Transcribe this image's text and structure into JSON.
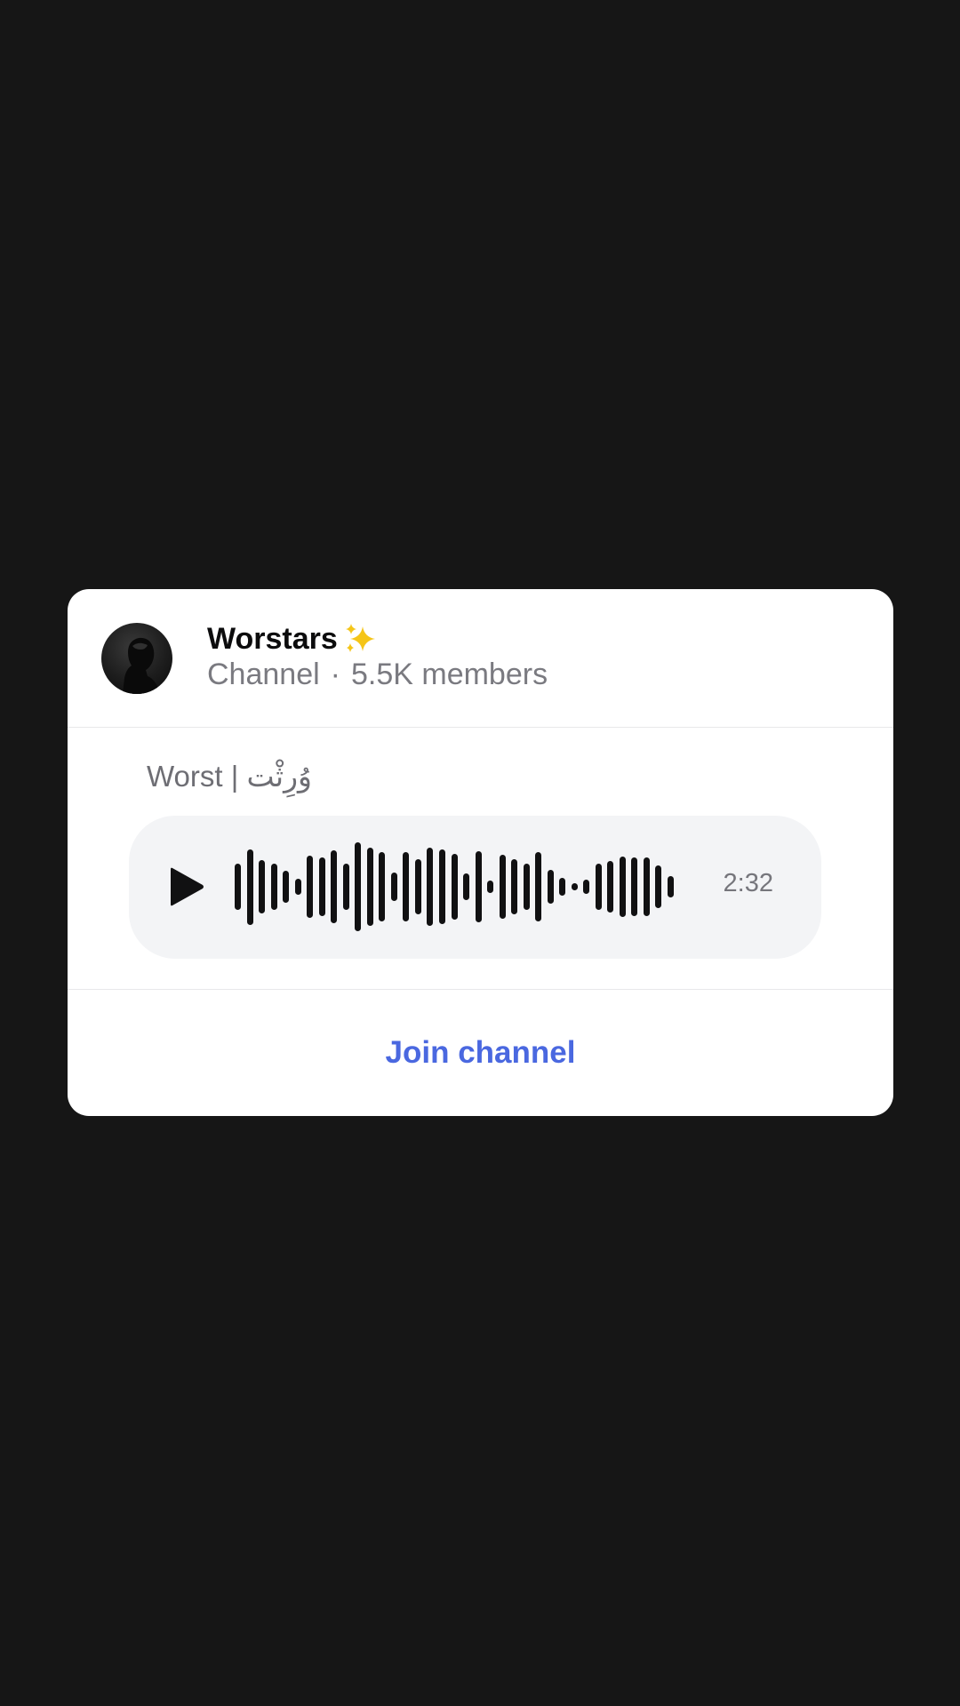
{
  "channel": {
    "name": "Worstars",
    "name_emoji_icon": "sparkles-icon",
    "type_label": "Channel",
    "separator": "·",
    "members": "5.5K members"
  },
  "post": {
    "title": "Worst | وُرِثْت"
  },
  "voice_message": {
    "play_icon": "play-icon",
    "duration": "2:32",
    "waveform_levels": [
      0.52,
      0.85,
      0.6,
      0.52,
      0.36,
      0.18,
      0.7,
      0.66,
      0.82,
      0.52,
      1.0,
      0.88,
      0.78,
      0.32,
      0.78,
      0.62,
      0.88,
      0.84,
      0.74,
      0.3,
      0.8,
      0.14,
      0.72,
      0.62,
      0.52,
      0.78,
      0.38,
      0.2,
      0.08,
      0.16,
      0.52,
      0.58,
      0.68,
      0.66,
      0.66,
      0.48,
      0.24
    ]
  },
  "actions": {
    "join_label": "Join channel"
  },
  "colors": {
    "background": "#161616",
    "card": "#ffffff",
    "player": "#f3f4f6",
    "accent": "#4a68e0",
    "waveform": "#111112"
  }
}
